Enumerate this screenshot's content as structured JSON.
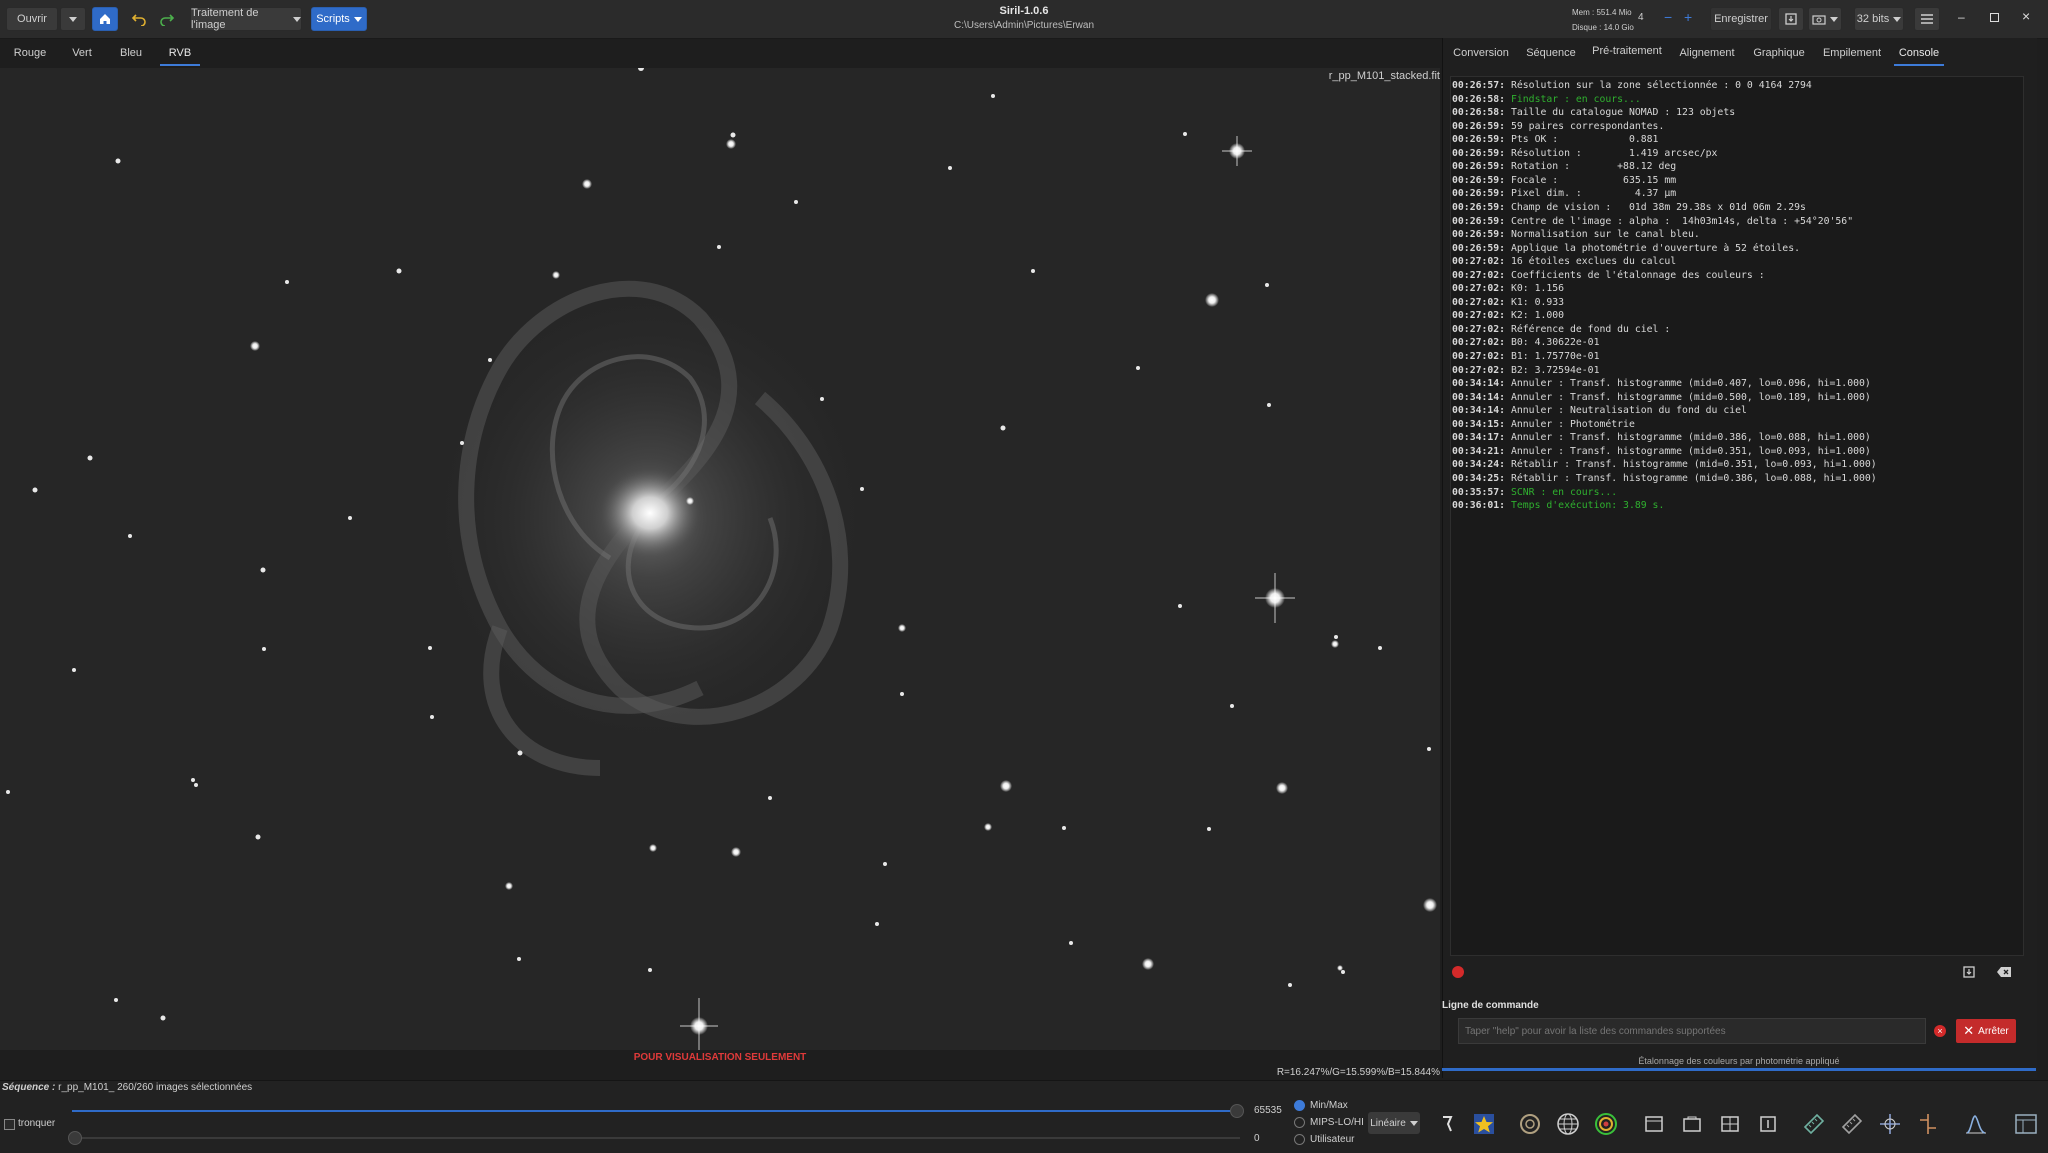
{
  "header": {
    "open_label": "Ouvrir",
    "image_processing_label": "Traitement de l'image",
    "scripts_label": "Scripts",
    "title": "Siril-1.0.6",
    "path": "C:\\Users\\Admin\\Pictures\\Erwan",
    "mem": "Mem : 551.4 Mio",
    "disk": "Disque : 14.0 Gio",
    "threads": "4",
    "save_label": "Enregistrer",
    "bit_depth": "32 bits"
  },
  "channel_tabs": [
    "Rouge",
    "Vert",
    "Bleu",
    "RVB"
  ],
  "image": {
    "filename": "r_pp_M101_stacked.fit",
    "viz_only": "POUR VISUALISATION SEULEMENT",
    "pixel_values": "R=16.247%/G=15.599%/B=15.844%"
  },
  "panel_tabs": [
    "Conversion",
    "Séquence",
    "Pré-traitement",
    "Alignement",
    "Graphique",
    "Empilement",
    "Console"
  ],
  "console": {
    "lines": [
      {
        "t": "00:26:57:",
        "m": " Résolution sur la zone sélectionnée : 0 0 4164 2794"
      },
      {
        "t": "00:26:58:",
        "m": " Findstar : en cours...",
        "green": true
      },
      {
        "t": "00:26:58:",
        "m": " Taille du catalogue NOMAD : 123 objets"
      },
      {
        "t": "00:26:59:",
        "m": " 59 paires correspondantes."
      },
      {
        "t": "00:26:59:",
        "m": " Pts OK :            0.881"
      },
      {
        "t": "00:26:59:",
        "m": " Résolution :        1.419 arcsec/px"
      },
      {
        "t": "00:26:59:",
        "m": " Rotation :        +88.12 deg"
      },
      {
        "t": "00:26:59:",
        "m": " Focale :           635.15 mm"
      },
      {
        "t": "00:26:59:",
        "m": " Pixel dim. :         4.37 µm"
      },
      {
        "t": "00:26:59:",
        "m": " Champ de vision :   01d 38m 29.38s x 01d 06m 2.29s"
      },
      {
        "t": "00:26:59:",
        "m": " Centre de l'image : alpha :  14h03m14s, delta : +54°20'56\""
      },
      {
        "t": "00:26:59:",
        "m": " Normalisation sur le canal bleu."
      },
      {
        "t": "00:26:59:",
        "m": " Applique la photométrie d'ouverture à 52 étoiles."
      },
      {
        "t": "00:27:02:",
        "m": " 16 étoiles exclues du calcul"
      },
      {
        "t": "00:27:02:",
        "m": " Coefficients de l'étalonnage des couleurs :"
      },
      {
        "t": "00:27:02:",
        "m": " K0: 1.156"
      },
      {
        "t": "00:27:02:",
        "m": " K1: 0.933"
      },
      {
        "t": "00:27:02:",
        "m": " K2: 1.000"
      },
      {
        "t": "00:27:02:",
        "m": " Référence de fond du ciel :"
      },
      {
        "t": "00:27:02:",
        "m": " B0: 4.30622e-01"
      },
      {
        "t": "00:27:02:",
        "m": " B1: 1.75770e-01"
      },
      {
        "t": "00:27:02:",
        "m": " B2: 3.72594e-01"
      },
      {
        "t": "00:34:14:",
        "m": " Annuler : Transf. histogramme (mid=0.407, lo=0.096, hi=1.000)"
      },
      {
        "t": "00:34:14:",
        "m": " Annuler : Transf. histogramme (mid=0.500, lo=0.189, hi=1.000)"
      },
      {
        "t": "00:34:14:",
        "m": " Annuler : Neutralisation du fond du ciel"
      },
      {
        "t": "00:34:15:",
        "m": " Annuler : Photométrie"
      },
      {
        "t": "00:34:17:",
        "m": " Annuler : Transf. histogramme (mid=0.386, lo=0.088, hi=1.000)"
      },
      {
        "t": "00:34:21:",
        "m": " Annuler : Transf. histogramme (mid=0.351, lo=0.093, hi=1.000)"
      },
      {
        "t": "00:34:24:",
        "m": " Rétablir : Transf. histogramme (mid=0.351, lo=0.093, hi=1.000)"
      },
      {
        "t": "00:34:25:",
        "m": " Rétablir : Transf. histogramme (mid=0.386, lo=0.088, hi=1.000)"
      },
      {
        "t": "00:35:57:",
        "m": " SCNR : en cours...",
        "green": true
      },
      {
        "t": "00:36:01:",
        "m": " Temps d'exécution: 3.89 s.",
        "green": true
      }
    ]
  },
  "command": {
    "label": "Ligne de commande",
    "placeholder": "Taper \"help\" pour avoir la liste des commandes supportées",
    "stop_label": "Arrêter",
    "status": "Étalonnage des couleurs par photométrie appliqué"
  },
  "bottom": {
    "sequence_label": "Séquence :",
    "sequence_value": " r_pp_M101_ 260/260 images sélectionnées",
    "truncate_label": "tronquer",
    "max_value": "65535",
    "min_value": "0",
    "radio_minmax": "Min/Max",
    "radio_mips": "MIPS-LO/HI",
    "radio_user": "Utilisateur",
    "scale_mode": "Linéaire"
  },
  "colors": {
    "accent": "#3d7bd9",
    "stop_button": "#c42b2b",
    "console_green": "#2fb02f",
    "warning_red": "#e03a3a"
  },
  "icons": [
    "home-icon",
    "undo-icon",
    "redo-icon",
    "save-icon",
    "camera-icon",
    "menu-icon",
    "record-icon",
    "clear-icon",
    "star-icon",
    "globe-icon",
    "target-icon",
    "histogram-icon"
  ]
}
